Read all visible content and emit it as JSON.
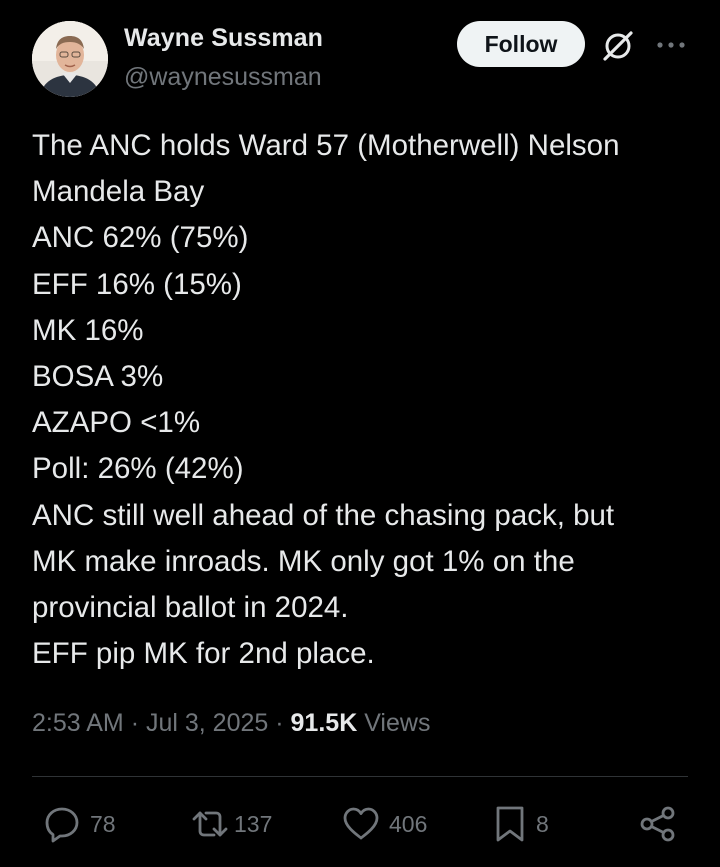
{
  "author": {
    "display_name": "Wayne Sussman",
    "handle": "@waynesussman"
  },
  "header": {
    "follow_label": "Follow",
    "grok_icon": "grok-icon",
    "more_icon": "more-icon"
  },
  "tweet": {
    "lines": [
      "The ANC holds Ward 57 (Motherwell) Nelson",
      "Mandela Bay",
      "ANC 62% (75%)",
      "EFF 16% (15%)",
      "MK 16%",
      "BOSA 3%",
      "AZAPO <1%",
      "Poll: 26% (42%)",
      "ANC still well ahead of the chasing pack, but",
      "MK make inroads. MK only got 1% on the",
      "provincial ballot in 2024.",
      "EFF pip MK for 2nd place."
    ]
  },
  "meta": {
    "time": "2:53 AM",
    "date": "Jul 3, 2025",
    "separator": "·",
    "views_count": "91.5K",
    "views_label": "Views"
  },
  "actions": {
    "replies": "78",
    "reposts": "137",
    "likes": "406",
    "bookmarks": "8"
  },
  "colors": {
    "background": "#000000",
    "text_primary": "#e7e9ea",
    "text_secondary": "#71767b",
    "divider": "#2f3336",
    "follow_bg": "#eff3f4"
  }
}
